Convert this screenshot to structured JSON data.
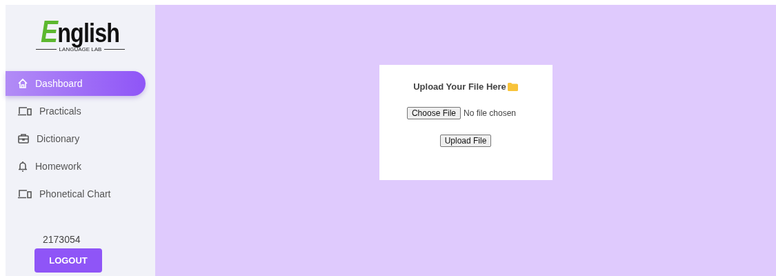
{
  "logo": {
    "word": "English",
    "tagline": "LANGUAGE LAB"
  },
  "sidebar": {
    "items": [
      {
        "label": "Dashboard",
        "selected": true
      },
      {
        "label": "Practicals",
        "selected": false
      },
      {
        "label": "Dictionary",
        "selected": false
      },
      {
        "label": "Homework",
        "selected": false
      },
      {
        "label": "Phonetical Chart",
        "selected": false
      }
    ],
    "user_id": "2173054",
    "logout": "LOGOUT"
  },
  "upload_card": {
    "title": "Upload Your File Here",
    "choose_button": "Choose File",
    "file_status": "No file chosen",
    "upload_button": "Upload File"
  }
}
